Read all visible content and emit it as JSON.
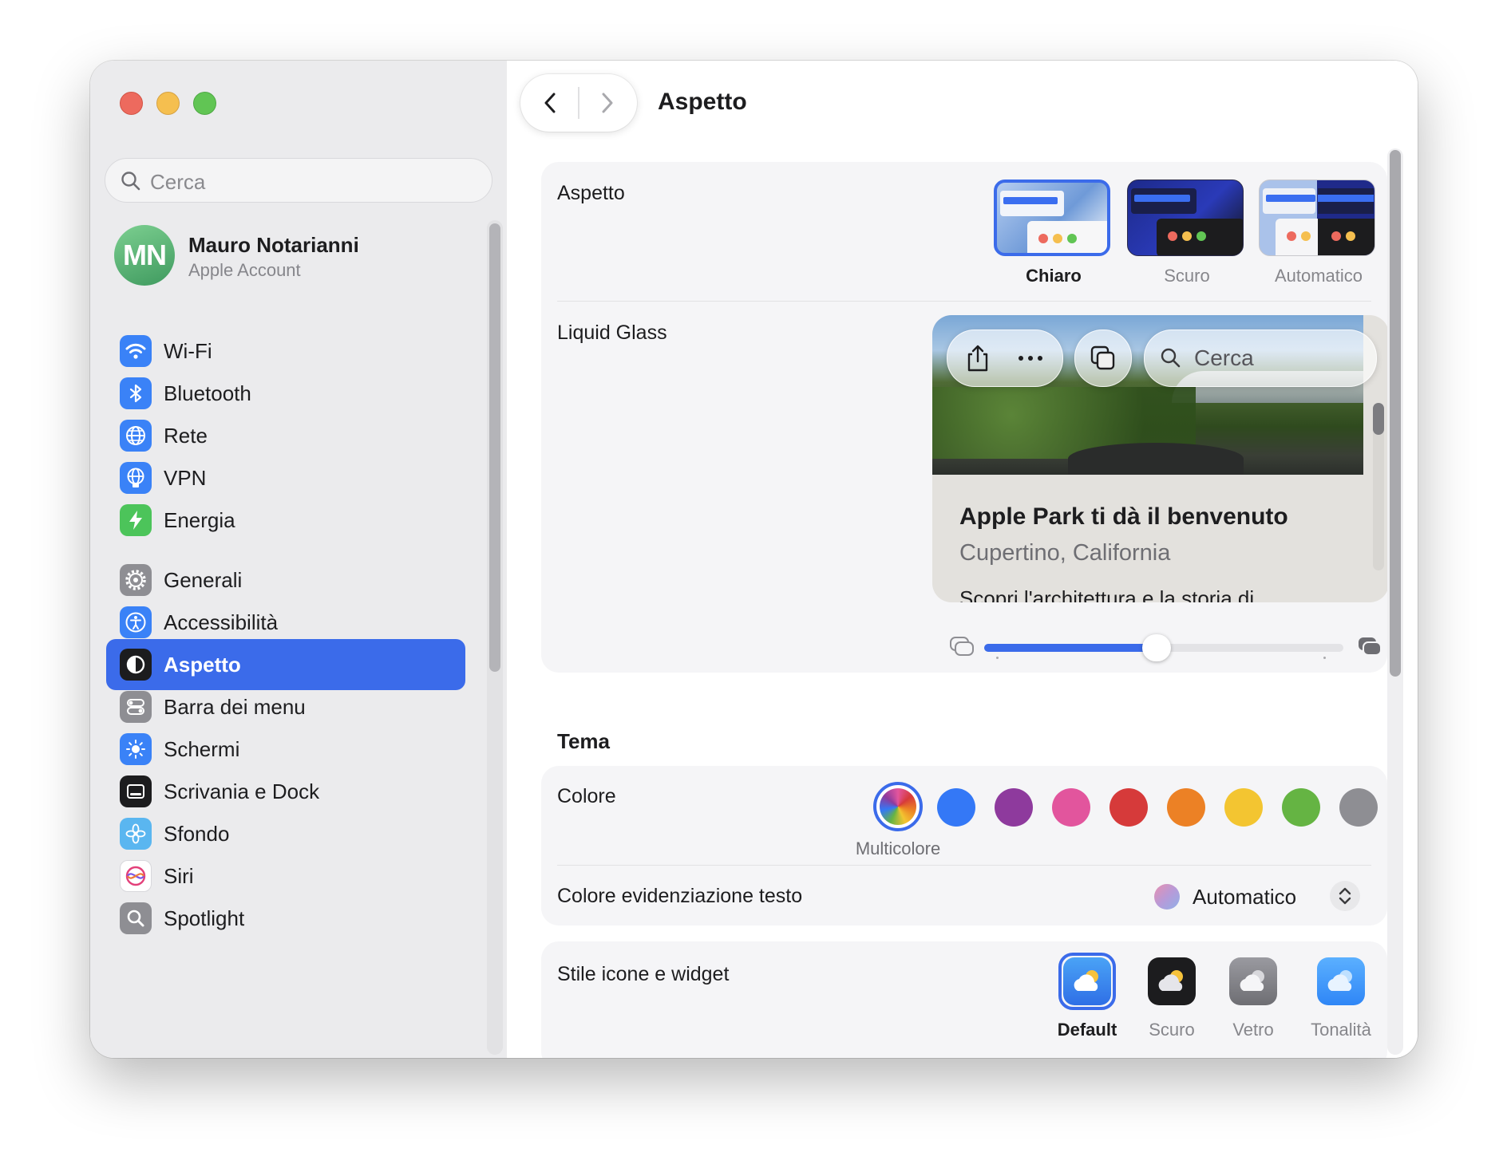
{
  "sidebar": {
    "search_placeholder": "Cerca",
    "account": {
      "initials": "MN",
      "name": "Mauro Notarianni",
      "subtitle": "Apple Account"
    },
    "items": [
      {
        "label": "Wi-Fi",
        "icon": "wifi-icon"
      },
      {
        "label": "Bluetooth",
        "icon": "bluetooth-icon"
      },
      {
        "label": "Rete",
        "icon": "globe-icon"
      },
      {
        "label": "VPN",
        "icon": "vpn-globe-icon"
      },
      {
        "label": "Energia",
        "icon": "bolt-icon"
      },
      {
        "label": "Generali",
        "icon": "gear-icon"
      },
      {
        "label": "Accessibilità",
        "icon": "accessibility-icon"
      },
      {
        "label": "Aspetto",
        "icon": "appearance-icon",
        "selected": true
      },
      {
        "label": "Barra dei menu",
        "icon": "menubar-toggle-icon"
      },
      {
        "label": "Schermi",
        "icon": "sun-icon"
      },
      {
        "label": "Scrivania e Dock",
        "icon": "dock-icon"
      },
      {
        "label": "Sfondo",
        "icon": "flower-icon"
      },
      {
        "label": "Siri",
        "icon": "siri-icon"
      },
      {
        "label": "Spotlight",
        "icon": "magnifier-icon"
      }
    ]
  },
  "header": {
    "title": "Aspetto"
  },
  "appearance": {
    "label": "Aspetto",
    "options": [
      {
        "label": "Chiaro",
        "selected": true
      },
      {
        "label": "Scuro",
        "selected": false
      },
      {
        "label": "Automatico",
        "selected": false
      }
    ]
  },
  "liquid_glass": {
    "label": "Liquid Glass",
    "preview": {
      "search_placeholder": "Cerca",
      "title": "Apple Park ti dà il benvenuto",
      "subtitle": "Cupertino, California",
      "body": "Scopri l'architettura e la storia di"
    },
    "slider_value": 0.48
  },
  "theme": {
    "heading": "Tema",
    "color_label": "Colore",
    "selected_color_name": "Multicolore",
    "colors": [
      "multicolor",
      "#3478f6",
      "#8e3a9d",
      "#e2559d",
      "#d63a3a",
      "#ec8125",
      "#f3c531",
      "#65b443",
      "#8e8e93"
    ],
    "highlight_label": "Colore evidenziazione testo",
    "highlight_value": "Automatico"
  },
  "icon_style": {
    "label": "Stile icone e widget",
    "options": [
      {
        "label": "Default",
        "selected": true
      },
      {
        "label": "Scuro",
        "selected": false
      },
      {
        "label": "Vetro",
        "selected": false
      },
      {
        "label": "Tonalità",
        "selected": false
      }
    ]
  },
  "accent_color": "#3b6bea"
}
